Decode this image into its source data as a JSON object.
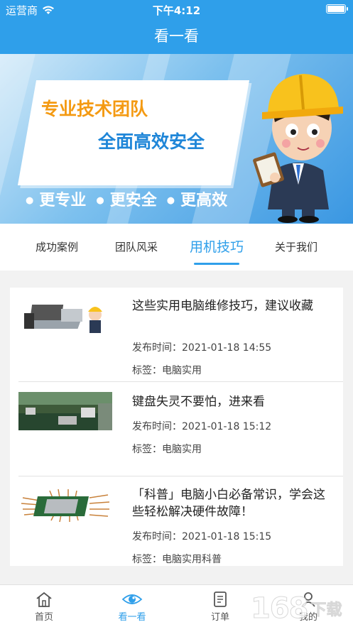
{
  "status_bar": {
    "carrier": "运营商",
    "time": "下午4:12"
  },
  "nav": {
    "title": "看一看"
  },
  "banner": {
    "headline": "专业技术团队",
    "subheadline": "全面高效安全",
    "slogans": [
      "更专业",
      "更安全",
      "更高效"
    ]
  },
  "tabs": [
    {
      "label": "成功案例",
      "active": false
    },
    {
      "label": "团队风采",
      "active": false
    },
    {
      "label": "用机技巧",
      "active": true
    },
    {
      "label": "关于我们",
      "active": false
    }
  ],
  "articles": [
    {
      "title": "这些实用电脑维修技巧，建议收藏",
      "time": "发布时间：2021-01-18 14:55",
      "tags": "标签：电脑实用",
      "thumb_icon": "computer-repair-thumbnail"
    },
    {
      "title": "键盘失灵不要怕，进来看",
      "time": "发布时间：2021-01-18 15:12",
      "tags": "标签：电脑实用",
      "thumb_icon": "repair-workshop-thumbnail"
    },
    {
      "title": "「科普」电脑小白必备常识，学会这些轻松解决硬件故障！",
      "time": "发布时间：2021-01-18 15:15",
      "tags": "标签：电脑实用科普",
      "thumb_icon": "cpu-chip-thumbnail"
    }
  ],
  "bottom_nav": [
    {
      "label": "首页",
      "icon": "home-icon",
      "active": false
    },
    {
      "label": "看一看",
      "icon": "eye-icon",
      "active": true
    },
    {
      "label": "订单",
      "icon": "order-icon",
      "active": false
    },
    {
      "label": "我的",
      "icon": "user-icon",
      "active": false
    }
  ],
  "watermark": {
    "number": "168",
    "text": "下载"
  },
  "colors": {
    "primary": "#2f9fea",
    "banner_orange": "#f49a12",
    "banner_blue": "#1f86d8"
  }
}
